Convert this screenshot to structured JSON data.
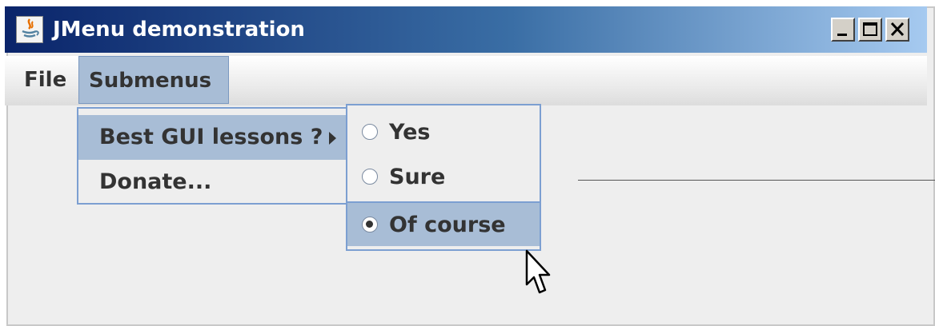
{
  "window": {
    "title": "JMenu demonstration",
    "icon": "java-icon",
    "controls": [
      "minimize-icon",
      "maximize-icon",
      "close-icon"
    ]
  },
  "menubar": {
    "items": [
      {
        "label": "File"
      },
      {
        "label": "Submenus",
        "open": true
      }
    ]
  },
  "submenus_popup": {
    "items": [
      {
        "label": "Best GUI lessons ?",
        "has_submenu": true,
        "highlighted": true
      },
      {
        "label": "Donate..."
      }
    ]
  },
  "lessons_submenu": {
    "items": [
      {
        "label": "Yes",
        "type": "radio",
        "selected": false
      },
      {
        "label": "Sure",
        "type": "radio",
        "selected": false
      },
      {
        "label": "Of course",
        "type": "radio",
        "selected": true,
        "highlighted": true
      }
    ]
  },
  "colors": {
    "titlebar_start": "#0a246a",
    "titlebar_end": "#a6caf0",
    "selection": "#a8bdd6",
    "popup_border": "#7c9fd1",
    "background": "#eeeeee"
  }
}
